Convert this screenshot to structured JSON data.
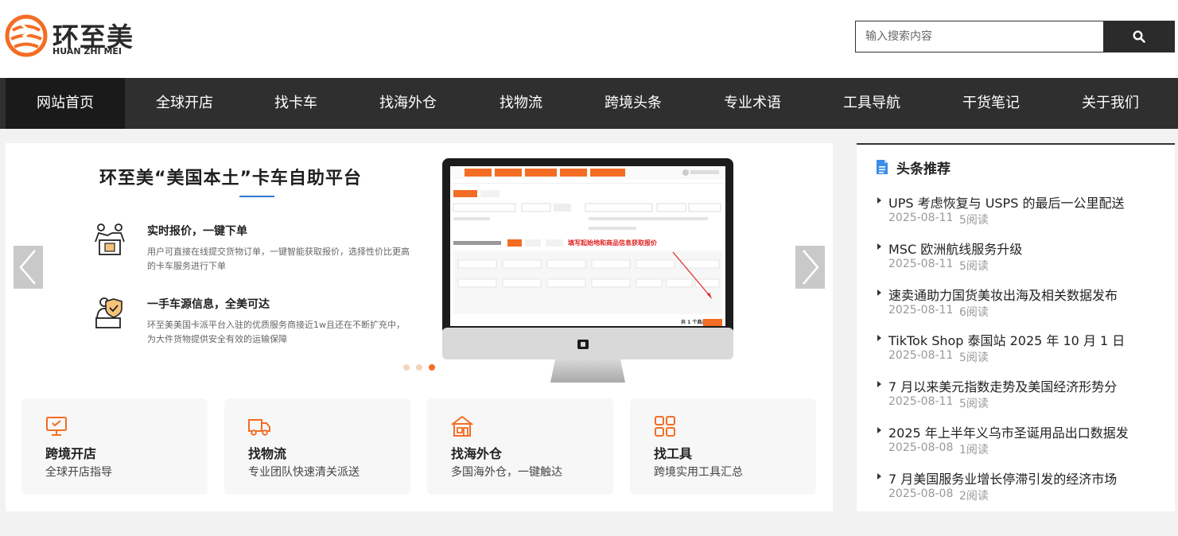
{
  "logo": {
    "name_cn": "环至美",
    "name_en": "HUAN ZHI MEI"
  },
  "search": {
    "placeholder": "输入搜索内容"
  },
  "colors": {
    "accent": "#f36d24",
    "nav_bg": "#2f2f2f",
    "nav_active": "#1a1a1a",
    "title_underline": "#2f7ad1",
    "side_icon": "#3a8ee6"
  },
  "nav": [
    {
      "label": "网站首页",
      "active": true
    },
    {
      "label": "全球开店"
    },
    {
      "label": "找卡车"
    },
    {
      "label": "找海外仓"
    },
    {
      "label": "找物流"
    },
    {
      "label": "跨境头条"
    },
    {
      "label": "专业术语"
    },
    {
      "label": "工具导航"
    },
    {
      "label": "干货笔记"
    },
    {
      "label": "关于我们"
    }
  ],
  "banner": {
    "title": "环至美“美国本土”卡车自助平台",
    "features": [
      {
        "icon": "handshake-icon",
        "title": "实时报价，一键下单",
        "desc": "用户可直接在线提交货物订单，一键智能获取报价，选择性价比更高的卡车服务进行下单"
      },
      {
        "icon": "delivery-shield-icon",
        "title": "一手车源信息，全美可达",
        "desc": "环至美美国卡派平台入驻的优质服务商接近1w且还在不断扩充中，为大件货物提供安全有效的运输保障"
      }
    ],
    "screen": {
      "annotation": "填写起始地和商品信息获取报价",
      "footer": "共 1 个商品"
    },
    "slide_count": 3,
    "active_slide": 3
  },
  "cards": [
    {
      "icon": "monitor-icon",
      "title": "跨境开店",
      "sub": "全球开店指导"
    },
    {
      "icon": "truck-icon",
      "title": "找物流",
      "sub": "专业团队快速清关派送"
    },
    {
      "icon": "warehouse-icon",
      "title": "找海外仓",
      "sub": "多国海外仓，一键触达"
    },
    {
      "icon": "grid-tools-icon",
      "title": "找工具",
      "sub": "跨境实用工具汇总"
    }
  ],
  "side": {
    "title": "头条推荐",
    "news": [
      {
        "title": "UPS 考虑恢复与 USPS 的最后一公里配送",
        "date": "2025-08-11",
        "reads": "5阅读"
      },
      {
        "title": "MSC 欧洲航线服务升级",
        "date": "2025-08-11",
        "reads": "5阅读"
      },
      {
        "title": "速卖通助力国货美妆出海及相关数据发布",
        "date": "2025-08-11",
        "reads": "6阅读"
      },
      {
        "title": "TikTok Shop 泰国站 2025 年 10 月 1 日",
        "date": "2025-08-11",
        "reads": "5阅读"
      },
      {
        "title": "7 月以来美元指数走势及美国经济形势分",
        "date": "2025-08-11",
        "reads": "5阅读"
      },
      {
        "title": "2025 年上半年义乌市圣诞用品出口数据发",
        "date": "2025-08-08",
        "reads": "1阅读"
      },
      {
        "title": "7 月美国服务业增长停滞引发的经济市场",
        "date": "2025-08-08",
        "reads": "2阅读"
      }
    ]
  }
}
